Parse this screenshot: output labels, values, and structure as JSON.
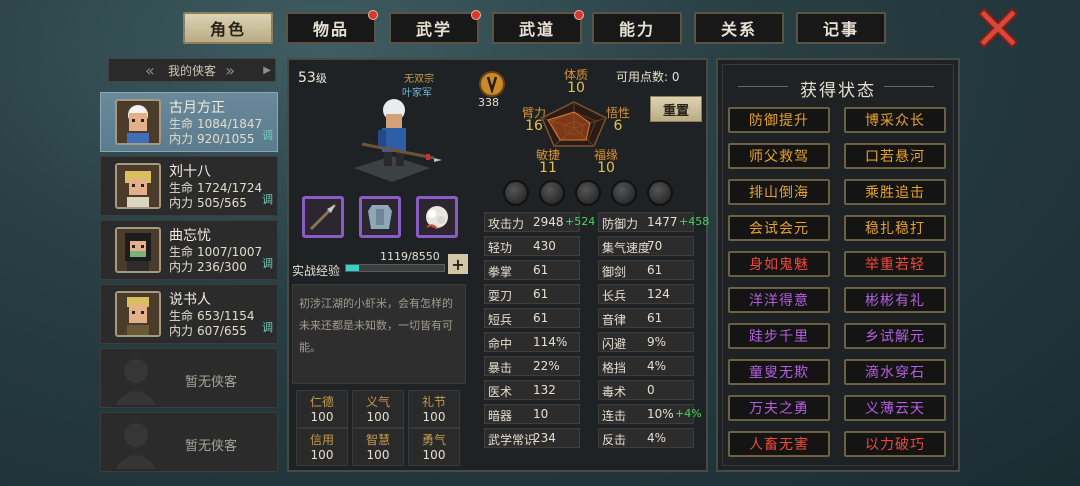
{
  "tabs": [
    {
      "label": "角色",
      "active": true,
      "dot": false
    },
    {
      "label": "物品",
      "active": false,
      "dot": true
    },
    {
      "label": "武学",
      "active": false,
      "dot": true
    },
    {
      "label": "武道",
      "active": false,
      "dot": true
    },
    {
      "label": "能力",
      "active": false,
      "dot": false
    },
    {
      "label": "关系",
      "active": false,
      "dot": false
    },
    {
      "label": "记事",
      "active": false,
      "dot": false
    }
  ],
  "roster": {
    "title": "我的侠客",
    "members": [
      {
        "name": "古月方正",
        "hp_label": "生命",
        "hp": "1084/1847",
        "mp_label": "内力",
        "mp": "920/1055",
        "adjust": "调",
        "selected": true
      },
      {
        "name": "刘十八",
        "hp_label": "生命",
        "hp": "1724/1724",
        "mp_label": "内力",
        "mp": "505/565",
        "adjust": "调",
        "selected": false
      },
      {
        "name": "曲忘忧",
        "hp_label": "生命",
        "hp": "1007/1007",
        "mp_label": "内力",
        "mp": "236/300",
        "adjust": "调",
        "selected": false
      },
      {
        "name": "说书人",
        "hp_label": "生命",
        "hp": "653/1154",
        "mp_label": "内力",
        "mp": "607/655",
        "adjust": "调",
        "selected": false
      }
    ],
    "empty_label": "暂无侠客"
  },
  "character": {
    "level": "53",
    "level_unit": "级",
    "sect": "无双宗",
    "faction": "叶家军",
    "exp_label": "实战经验",
    "exp_value": "1119/8550",
    "exp_fraction": 0.131,
    "description": "初涉江湖的小虾米，会有怎样的未来还都是未知数，一切皆有可能。",
    "virtues": [
      {
        "k": "仁德",
        "v": "100"
      },
      {
        "k": "义气",
        "v": "100"
      },
      {
        "k": "礼节",
        "v": "100"
      },
      {
        "k": "信用",
        "v": "100"
      },
      {
        "k": "智慧",
        "v": "100"
      },
      {
        "k": "勇气",
        "v": "100"
      }
    ],
    "medal_value": "338",
    "points_label": "可用点数: 0",
    "reset_label": "重置",
    "attributes": {
      "tizhi": {
        "k": "体质",
        "v": "10"
      },
      "bili": {
        "k": "臂力",
        "v": "16"
      },
      "wuxing": {
        "k": "悟性",
        "v": "6"
      },
      "minjie": {
        "k": "敏捷",
        "v": "11"
      },
      "fuyuan": {
        "k": "福缘",
        "v": "10"
      }
    },
    "stats_left": [
      {
        "k": "攻击力",
        "v": "2948",
        "b": "+524"
      },
      {
        "k": "轻功",
        "v": "430",
        "b": ""
      },
      {
        "k": "拳掌",
        "v": "61",
        "b": ""
      },
      {
        "k": "耍刀",
        "v": "61",
        "b": ""
      },
      {
        "k": "短兵",
        "v": "61",
        "b": ""
      },
      {
        "k": "命中",
        "v": "114%",
        "b": ""
      },
      {
        "k": "暴击",
        "v": "22%",
        "b": ""
      },
      {
        "k": "医术",
        "v": "132",
        "b": ""
      },
      {
        "k": "暗器",
        "v": "10",
        "b": ""
      },
      {
        "k": "武学常识",
        "v": "234",
        "b": ""
      }
    ],
    "stats_right": [
      {
        "k": "防御力",
        "v": "1477",
        "b": "+458"
      },
      {
        "k": "集气速度",
        "v": "70",
        "b": ""
      },
      {
        "k": "御剑",
        "v": "61",
        "b": ""
      },
      {
        "k": "长兵",
        "v": "124",
        "b": ""
      },
      {
        "k": "音律",
        "v": "61",
        "b": ""
      },
      {
        "k": "闪避",
        "v": "9%",
        "b": ""
      },
      {
        "k": "格挡",
        "v": "4%",
        "b": ""
      },
      {
        "k": "毒术",
        "v": "0",
        "b": ""
      },
      {
        "k": "连击",
        "v": "10%",
        "b": "+4%"
      },
      {
        "k": "反击",
        "v": "4%",
        "b": ""
      }
    ]
  },
  "status_panel": {
    "title": "获得状态",
    "badges": [
      {
        "label": "防御提升",
        "color": "#e6a22a"
      },
      {
        "label": "博采众长",
        "color": "#e6a22a"
      },
      {
        "label": "师父救驾",
        "color": "#e6a22a"
      },
      {
        "label": "口若悬河",
        "color": "#e6a22a"
      },
      {
        "label": "排山倒海",
        "color": "#e6a22a"
      },
      {
        "label": "乘胜追击",
        "color": "#e6a22a"
      },
      {
        "label": "会试会元",
        "color": "#e6a22a"
      },
      {
        "label": "稳扎稳打",
        "color": "#e6a22a"
      },
      {
        "label": "身如鬼魅",
        "color": "#ee4a3a"
      },
      {
        "label": "举重若轻",
        "color": "#ee4a3a"
      },
      {
        "label": "洋洋得意",
        "color": "#b45ee0"
      },
      {
        "label": "彬彬有礼",
        "color": "#b45ee0"
      },
      {
        "label": "跬步千里",
        "color": "#b45ee0"
      },
      {
        "label": "乡试解元",
        "color": "#b45ee0"
      },
      {
        "label": "童叟无欺",
        "color": "#b45ee0"
      },
      {
        "label": "滴水穿石",
        "color": "#b45ee0"
      },
      {
        "label": "万夫之勇",
        "color": "#b45ee0"
      },
      {
        "label": "义薄云天",
        "color": "#b45ee0"
      },
      {
        "label": "人畜无害",
        "color": "#ee4a3a"
      },
      {
        "label": "以力破巧",
        "color": "#ee4a3a"
      }
    ]
  }
}
